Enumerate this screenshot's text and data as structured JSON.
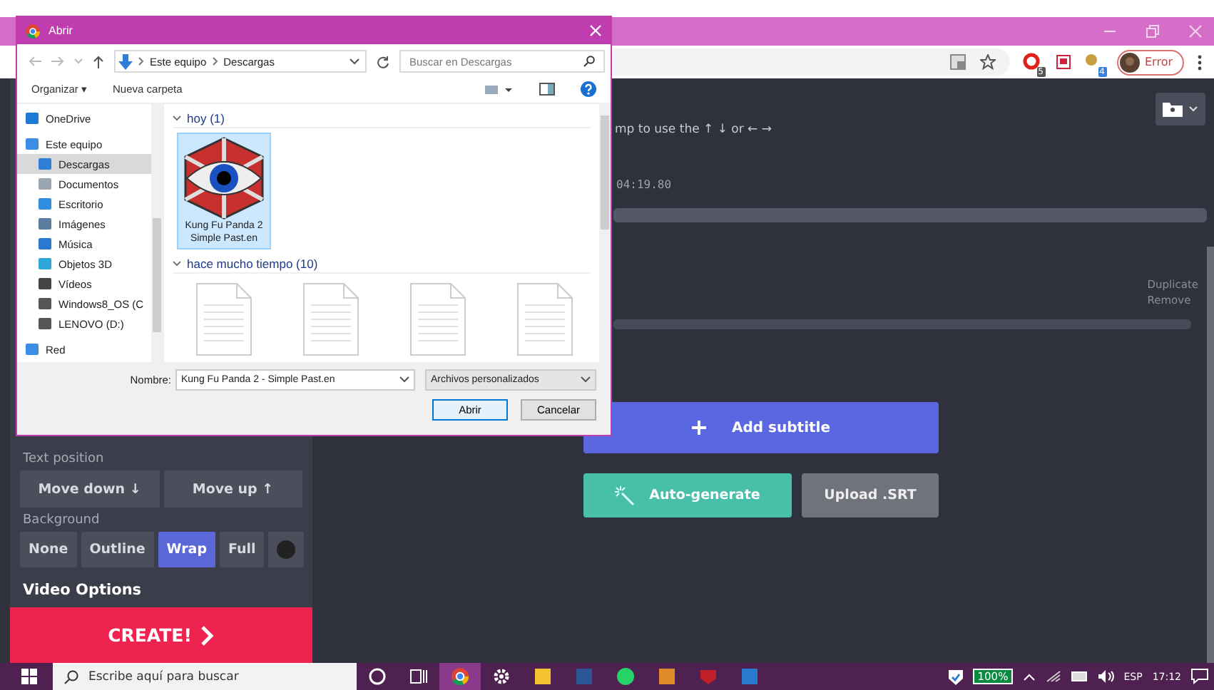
{
  "browser": {
    "profile_label": "Error",
    "extension_badges": [
      "5",
      "4"
    ]
  },
  "page": {
    "hint": "mp to use the ↑ ↓ or ← →",
    "timestamp": "04:19.80",
    "subtitle_actions": [
      "Duplicate",
      "Remove"
    ],
    "add_button": "Add subtitle",
    "auto_button": "Auto-generate",
    "upload_button": "Upload .SRT"
  },
  "sidebar": {
    "text_position_label": "Text position",
    "position_buttons": [
      "Move down ↓",
      "Move up ↑"
    ],
    "background_label": "Background",
    "background_options": [
      {
        "label": "None",
        "selected": false
      },
      {
        "label": "Outline",
        "selected": false
      },
      {
        "label": "Wrap",
        "selected": true
      },
      {
        "label": "Full",
        "selected": false
      }
    ],
    "video_options_label": "Video Options",
    "create_button": "CREATE!"
  },
  "dialog": {
    "title": "Abrir",
    "path": [
      "Este equipo",
      "Descargas"
    ],
    "search_placeholder": "Buscar en Descargas",
    "toolbar": [
      "Organizar ▾",
      "Nueva carpeta"
    ],
    "nav_items": [
      {
        "label": "OneDrive",
        "kind": "cloud",
        "selected": false
      },
      {
        "label": "Este equipo",
        "kind": "pc",
        "selected": false,
        "children": [
          {
            "label": "Descargas",
            "kind": "download",
            "selected": true
          },
          {
            "label": "Documentos",
            "kind": "docs",
            "selected": false
          },
          {
            "label": "Escritorio",
            "kind": "desktop",
            "selected": false
          },
          {
            "label": "Imágenes",
            "kind": "images",
            "selected": false
          },
          {
            "label": "Música",
            "kind": "music",
            "selected": false
          },
          {
            "label": "Objetos 3D",
            "kind": "cube",
            "selected": false
          },
          {
            "label": "Vídeos",
            "kind": "video",
            "selected": false
          },
          {
            "label": "Windows8_OS (C",
            "kind": "drive",
            "selected": false
          },
          {
            "label": "LENOVO (D:)",
            "kind": "drive",
            "selected": false
          }
        ]
      },
      {
        "label": "Red",
        "kind": "network",
        "selected": false
      }
    ],
    "groups": [
      {
        "title": "hoy (1)",
        "files": [
          {
            "name": "Kung Fu Panda 2 Simple Past.en",
            "kind": "app",
            "selected": true
          }
        ]
      },
      {
        "title": "hace mucho tiempo (10)",
        "files": [
          {
            "kind": "document",
            "selected": false
          },
          {
            "kind": "document",
            "selected": false
          },
          {
            "kind": "document",
            "selected": false
          },
          {
            "kind": "document",
            "selected": false
          }
        ]
      }
    ],
    "filename_label": "Nombre:",
    "filename_value": "Kung Fu Panda 2 - Simple Past.en",
    "filter": "Archivos personalizados",
    "buttons": [
      "Abrir",
      "Cancelar"
    ]
  },
  "taskbar": {
    "search_placeholder": "Escribe aquí para buscar",
    "apps": [
      {
        "kind": "cortana",
        "active": false
      },
      {
        "kind": "taskview",
        "active": false
      },
      {
        "kind": "chrome",
        "active": true
      },
      {
        "kind": "settings",
        "active": false
      },
      {
        "kind": "folder",
        "active": false
      },
      {
        "kind": "word",
        "active": false
      },
      {
        "kind": "chat",
        "active": false
      },
      {
        "kind": "app",
        "active": false
      },
      {
        "kind": "shield",
        "active": false
      },
      {
        "kind": "photos",
        "active": false
      }
    ],
    "battery": "100%",
    "language": "ESP",
    "time": "17:12"
  }
}
